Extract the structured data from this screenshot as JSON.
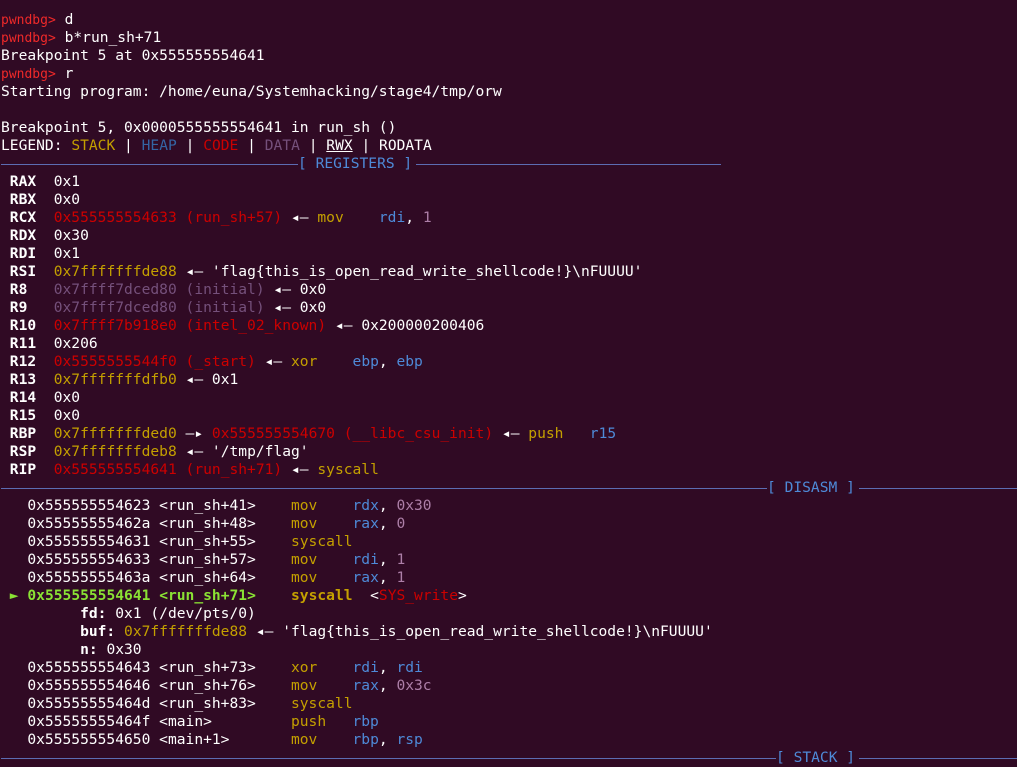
{
  "prompt": "pwndbg>",
  "colors": {
    "background": "#300a24",
    "prompt": "#ef2929",
    "stack": "#c4a000",
    "heap": "#3465a4",
    "code": "#cc0000",
    "data": "#75507b",
    "separator": "#5c6cb2",
    "current_line": "#8ae234"
  },
  "session": {
    "cmd1": "d",
    "cmd2": "b*run_sh+71",
    "bp_set": "Breakpoint 5 at 0x555555554641",
    "cmd3": "r",
    "starting": "Starting program: /home/euna/Systemhacking/stage4/tmp/orw",
    "bp_hit": "Breakpoint 5, 0x0000555555554641 in run_sh ()"
  },
  "legend": {
    "label": "LEGEND:",
    "stack": "STACK",
    "heap": "HEAP",
    "code": "CODE",
    "data": "DATA",
    "rwx": "RWX",
    "rodata": "RODATA",
    "sep": "|"
  },
  "sections": {
    "registers": "[ REGISTERS ]",
    "disasm": "[ DISASM ]",
    "stack": "[ STACK ]"
  },
  "registers": {
    "rax": {
      "name": "RAX",
      "value": "0x1"
    },
    "rbx": {
      "name": "RBX",
      "value": "0x0"
    },
    "rcx": {
      "name": "RCX",
      "addr": "0x555555554633",
      "sym": "(run_sh+57)",
      "arrow": "◂—",
      "mnem": "mov",
      "op1": "rdi",
      "comma": ",",
      "op2": "1"
    },
    "rdx": {
      "name": "RDX",
      "value": "0x30"
    },
    "rdi": {
      "name": "RDI",
      "value": "0x1"
    },
    "rsi": {
      "name": "RSI",
      "addr": "0x7fffffffde88",
      "arrow": "◂—",
      "str": "'flag{this_is_open_read_write_shellcode!}\\nFUUUU'"
    },
    "r8": {
      "name": "R8",
      "addr": "0x7ffff7dced80",
      "sym": "(initial)",
      "arrow": "◂—",
      "val": "0x0"
    },
    "r9": {
      "name": "R9",
      "addr": "0x7ffff7dced80",
      "sym": "(initial)",
      "arrow": "◂—",
      "val": "0x0"
    },
    "r10": {
      "name": "R10",
      "addr": "0x7ffff7b918e0",
      "sym": "(intel_02_known)",
      "arrow": "◂—",
      "val": "0x200000200406"
    },
    "r11": {
      "name": "R11",
      "value": "0x206"
    },
    "r12": {
      "name": "R12",
      "addr": "0x5555555544f0",
      "sym": "(_start)",
      "arrow": "◂—",
      "mnem": "xor",
      "op1": "ebp",
      "comma": ",",
      "op2": "ebp"
    },
    "r13": {
      "name": "R13",
      "addr": "0x7fffffffdfb0",
      "arrow": "◂—",
      "val": "0x1"
    },
    "r14": {
      "name": "R14",
      "value": "0x0"
    },
    "r15": {
      "name": "R15",
      "value": "0x0"
    },
    "rbp": {
      "name": "RBP",
      "addr": "0x7fffffffded0",
      "arrow1": "—▸",
      "addr2": "0x555555554670",
      "sym": "(__libc_csu_init)",
      "arrow": "◂—",
      "mnem": "push",
      "op1": "r15"
    },
    "rsp": {
      "name": "RSP",
      "addr": "0x7fffffffdeb8",
      "arrow": "◂—",
      "str": "'/tmp/flag'"
    },
    "rip": {
      "name": "RIP",
      "addr": "0x555555554641",
      "sym": "(run_sh+71)",
      "arrow": "◂—",
      "mnem": "syscall"
    }
  },
  "disasm": {
    "l1": {
      "addr": "0x555555554623",
      "sym": "<run_sh+41>",
      "mnem": "mov",
      "op1": "rdx",
      "comma": ",",
      "op2": "0x30"
    },
    "l2": {
      "addr": "0x55555555462a",
      "sym": "<run_sh+48>",
      "mnem": "mov",
      "op1": "rax",
      "comma": ",",
      "op2": "0"
    },
    "l3": {
      "addr": "0x555555554631",
      "sym": "<run_sh+55>",
      "mnem": "syscall"
    },
    "l4": {
      "addr": "0x555555554633",
      "sym": "<run_sh+57>",
      "mnem": "mov",
      "op1": "rdi",
      "comma": ",",
      "op2": "1"
    },
    "l5": {
      "addr": "0x55555555463a",
      "sym": "<run_sh+64>",
      "mnem": "mov",
      "op1": "rax",
      "comma": ",",
      "op2": "1"
    },
    "cur": {
      "marker": "►",
      "addr": "0x555555554641",
      "sym": "<run_sh+71>",
      "mnem": "syscall",
      "lt": "<",
      "sys": "SYS_write",
      "gt": ">"
    },
    "args": {
      "fd": {
        "label": "fd:",
        "value": "0x1 (/dev/pts/0)"
      },
      "buf": {
        "label": "buf:",
        "addr": "0x7fffffffde88",
        "arrow": "◂—",
        "str": "'flag{this_is_open_read_write_shellcode!}\\nFUUUU'"
      },
      "n": {
        "label": "n:",
        "value": "0x30"
      }
    },
    "l6": {
      "addr": "0x555555554643",
      "sym": "<run_sh+73>",
      "mnem": "xor",
      "op1": "rdi",
      "comma": ",",
      "op2": "rdi"
    },
    "l7": {
      "addr": "0x555555554646",
      "sym": "<run_sh+76>",
      "mnem": "mov",
      "op1": "rax",
      "comma": ",",
      "op2": "0x3c"
    },
    "l8": {
      "addr": "0x55555555464d",
      "sym": "<run_sh+83>",
      "mnem": "syscall"
    },
    "l9": {
      "addr": "0x55555555464f",
      "sym": "<main>",
      "mnem": "push",
      "op1": "rbp"
    },
    "l10": {
      "addr": "0x555555554650",
      "sym": "<main+1>",
      "mnem": "mov",
      "op1": "rbp",
      "comma": ",",
      "op2": "rsp"
    }
  },
  "partial_top": "————————————————————————————————————————————————————————————————————"
}
